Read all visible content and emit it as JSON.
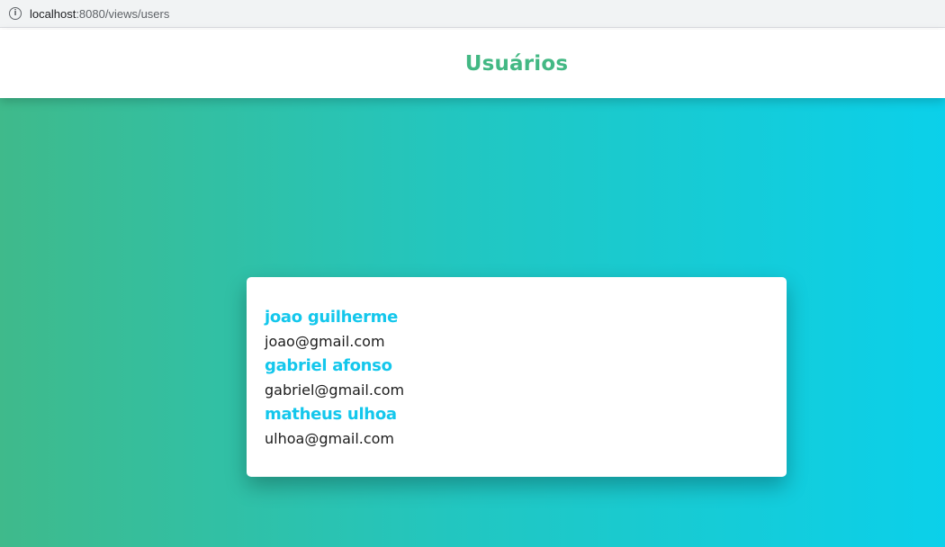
{
  "browser": {
    "url_host": "localhost",
    "url_path": ":8080/views/users",
    "info_icon": "info-icon"
  },
  "header": {
    "title": "Usuários"
  },
  "users": [
    {
      "name": "joao guilherme",
      "email": "joao@gmail.com"
    },
    {
      "name": "gabriel afonso",
      "email": "gabriel@gmail.com"
    },
    {
      "name": "matheus ulhoa",
      "email": "ulhoa@gmail.com"
    }
  ],
  "colors": {
    "title": "#43b884",
    "user_name": "#14c7ec",
    "gradient_start": "#3fba8b",
    "gradient_end": "#0bd0ea"
  }
}
